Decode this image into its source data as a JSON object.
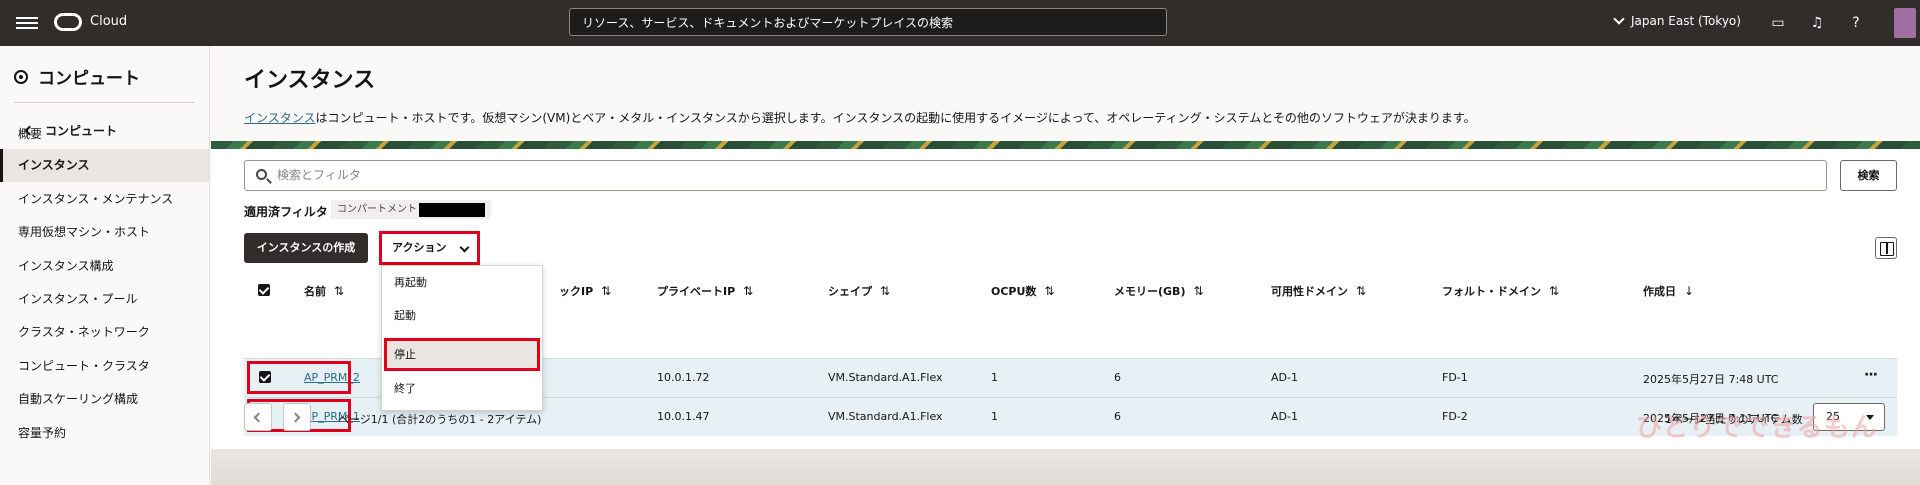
{
  "topbar": {
    "brand": "Cloud",
    "search_placeholder": "リソース、サービス、ドキュメントおよびマーケットプレイスの検索",
    "region": "Japan East (Tokyo)"
  },
  "sidebar": {
    "title": "コンピュート",
    "back_label": "コンピュート",
    "items": [
      {
        "label": "概要"
      },
      {
        "label": "インスタンス"
      },
      {
        "label": "インスタンス・メンテナンス"
      },
      {
        "label": "専用仮想マシン・ホスト"
      },
      {
        "label": "インスタンス構成"
      },
      {
        "label": "インスタンス・プール"
      },
      {
        "label": "クラスタ・ネットワーク"
      },
      {
        "label": "コンピュート・クラスタ"
      },
      {
        "label": "自動スケーリング構成"
      },
      {
        "label": "容量予約"
      }
    ]
  },
  "main": {
    "title": "インスタンス",
    "desc_link": "インスタンス",
    "desc_text": "はコンピュート・ホストです。仮想マシン(VM)とベア・メタル・インスタンスから選択します。インスタンスの起動に使用するイメージによって、オペレーティング・システムとその他のソフトウェアが決まります。",
    "filter_placeholder": "検索とフィルタ",
    "search_button": "検索",
    "applied_filters_label": "適用済フィルタ",
    "compartment_chip": "コンパートメント",
    "create_button": "インスタンスの作成",
    "action_button": "アクション"
  },
  "table": {
    "columns": [
      "名前",
      "ックIP",
      "プライベートIP",
      "シェイプ",
      "OCPU数",
      "メモリー(GB)",
      "可用性ドメイン",
      "フォルト・ドメイン",
      "作成日"
    ],
    "rows": [
      {
        "name": "AP_PRM_2",
        "private_ip": "10.0.1.72",
        "shape": "VM.Standard.A1.Flex",
        "ocpu": "1",
        "memory": "6",
        "ad": "AD-1",
        "fd": "FD-1",
        "created": "2025年5月27日 7:48 UTC"
      },
      {
        "name": "AP_PRM_1",
        "private_ip": "10.0.1.47",
        "shape": "VM.Standard.A1.Flex",
        "ocpu": "1",
        "memory": "6",
        "ad": "AD-1",
        "fd": "FD-2",
        "created": "2025年5月27日 7:11 UTC"
      }
    ]
  },
  "action_menu": {
    "items": [
      "再起動",
      "起動",
      "停止",
      "終了"
    ],
    "highlighted": "停止"
  },
  "pagination": {
    "summary": "ページ1/1 (合計2のうちの1 - 2アイテム)",
    "per_page_label": "1ページ当たりのアイテム数",
    "per_page_value": "25"
  },
  "watermark": "ひとりでできるもん",
  "colors": {
    "topbar": "#312d2a",
    "highlight_red": "#e0001b",
    "link": "#2a6c8a",
    "selected_row": "#e6f0f5"
  }
}
